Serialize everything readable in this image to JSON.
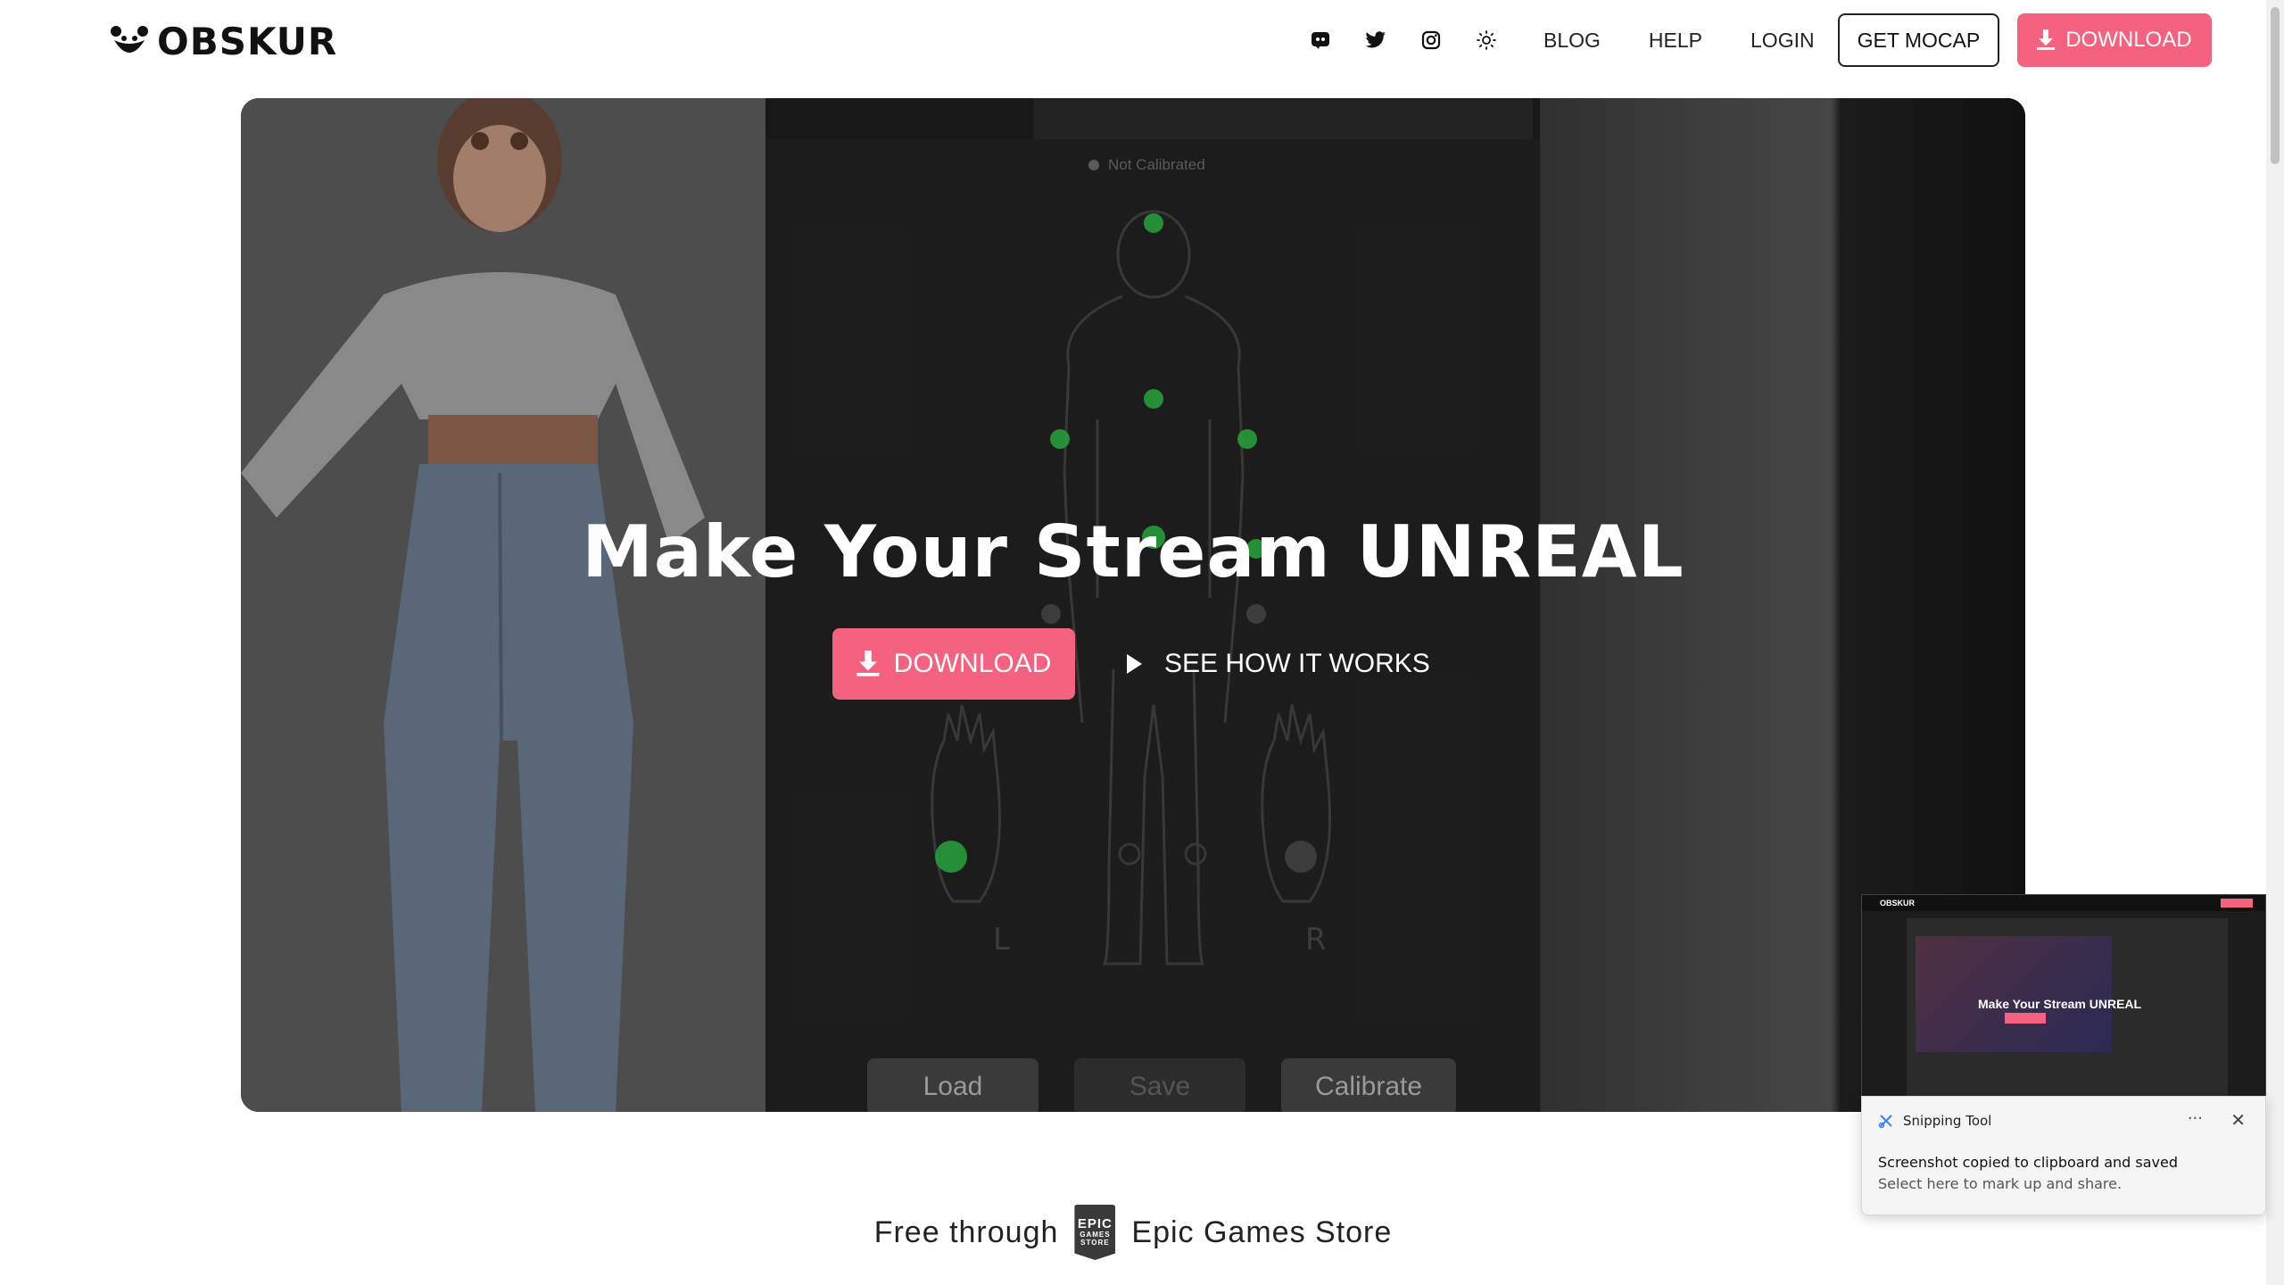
{
  "header": {
    "logo_text": "OBSKUR",
    "nav": {
      "icons": [
        "discord-icon",
        "twitter-icon",
        "instagram-icon",
        "theme-toggle-icon"
      ],
      "links": [
        "BLOG",
        "HELP",
        "LOGIN"
      ],
      "get_mocap": "GET MOCAP",
      "download": "DOWNLOAD"
    }
  },
  "hero": {
    "title": "Make Your Stream UNREAL",
    "download": "DOWNLOAD",
    "how": "SEE HOW IT WORKS",
    "app": {
      "status": "Not Calibrated",
      "hand_left": "L",
      "hand_right": "R",
      "buttons": [
        "Load",
        "Save",
        "Calibrate"
      ]
    }
  },
  "epic": {
    "prefix": "Free through",
    "badge_lines": [
      "EPIC",
      "GAMES",
      "STORE"
    ],
    "suffix": "Epic Games Store"
  },
  "toast": {
    "app": "Snipping Tool",
    "message": "Screenshot copied to clipboard and saved",
    "sub": "Select here to mark up and share.",
    "thumb_title": "Make Your Stream UNREAL",
    "thumb_logo": "OBSKUR"
  },
  "colors": {
    "accent": "#f4627f",
    "marker": "#2fc84a"
  }
}
